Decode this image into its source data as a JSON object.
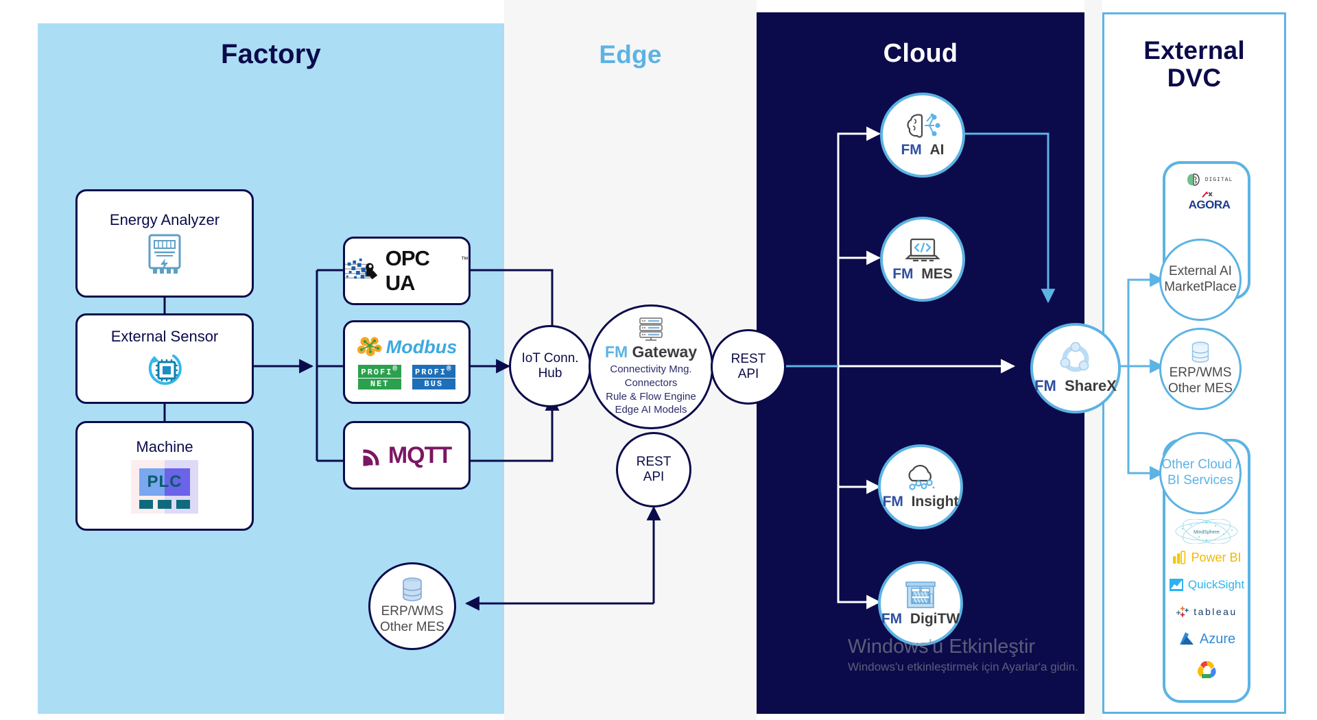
{
  "zones": {
    "factory": {
      "title": "Factory"
    },
    "edge": {
      "title": "Edge"
    },
    "cloud": {
      "title": "Cloud"
    },
    "external": {
      "title": "External\nDVC",
      "line1": "External",
      "line2": "DVC"
    }
  },
  "factory": {
    "devices": [
      {
        "label": "Energy Analyzer",
        "icon": "energy-meter-icon"
      },
      {
        "label": "External Sensor",
        "icon": "sensor-chip-icon"
      },
      {
        "label": "Machine",
        "icon": "plc-icon"
      }
    ],
    "protocols": [
      {
        "name": "OPC UA",
        "icon": "opc-ua-logo"
      },
      {
        "name": "Modbus",
        "icon": "modbus-logo",
        "sub": [
          "PROFINET",
          "PROFIBUS"
        ]
      },
      {
        "name": "MQTT",
        "icon": "mqtt-logo"
      }
    ],
    "erp_node": {
      "line1": "ERP/WMS",
      "line2": "Other MES",
      "icon": "database-icon"
    },
    "plc_text": "PLC"
  },
  "edge": {
    "iot_hub": {
      "line1": "IoT Conn.",
      "line2": "Hub"
    },
    "gateway": {
      "brand_fm": "FM",
      "brand_name": "Gateway",
      "features": [
        "Connectivity Mng.",
        "Connectors",
        "Rule & Flow Engine",
        "Edge AI Models"
      ],
      "icon": "server-stack-icon"
    },
    "rest_api_top": {
      "line1": "REST",
      "line2": "API"
    },
    "rest_api_bottom": {
      "line1": "REST",
      "line2": "API"
    }
  },
  "cloud": {
    "services": [
      {
        "fm": "FM",
        "name": "AI",
        "icon": "brain-circuit-icon"
      },
      {
        "fm": "FM",
        "name": "MES",
        "icon": "laptop-code-icon"
      },
      {
        "fm": "FM",
        "name": "Insight",
        "icon": "cloud-analytics-icon"
      },
      {
        "fm": "FM",
        "name": "DigiTW",
        "icon": "digital-twin-icon"
      }
    ],
    "sharex": {
      "fm": "FM",
      "name": "ShareX",
      "icon": "share-nodes-icon"
    }
  },
  "external_dvc": {
    "groups": [
      {
        "logos": [
          "DIGITAL",
          "AGORA"
        ],
        "node": {
          "line1": "External AI",
          "line2": "MarketPlace",
          "color": "#4A4A4A"
        }
      },
      {
        "logos": [],
        "node": {
          "line1": "ERP/WMS",
          "line2": "Other MES",
          "color": "#4A4A4A",
          "icon": "database-icon"
        }
      },
      {
        "logos": [
          "MindSphere",
          "Power BI",
          "QuickSight",
          "tableau",
          "Azure",
          "Google Cloud"
        ],
        "node": {
          "line1": "Other Cloud /",
          "line2": "BI Services",
          "color": "#5CB3E4"
        }
      }
    ]
  },
  "watermark": {
    "line1": "Windows'u Etkinleştir",
    "line2": "Windows'u etkinleştirmek için Ayarlar'a gidin."
  },
  "colors": {
    "factory_bg": "#ABDDF4",
    "edge_bg": "#F6F6F6",
    "cloud_bg": "#0B0B4B",
    "accent_light_blue": "#5CB3E4",
    "navy": "#0B0B4B",
    "mqtt_purple": "#7B1664",
    "profinet_green": "#2BA14E",
    "profibus_blue": "#1D6FB8",
    "modbus_blue": "#3BA9E0",
    "modbus_orange": "#F5A623"
  }
}
